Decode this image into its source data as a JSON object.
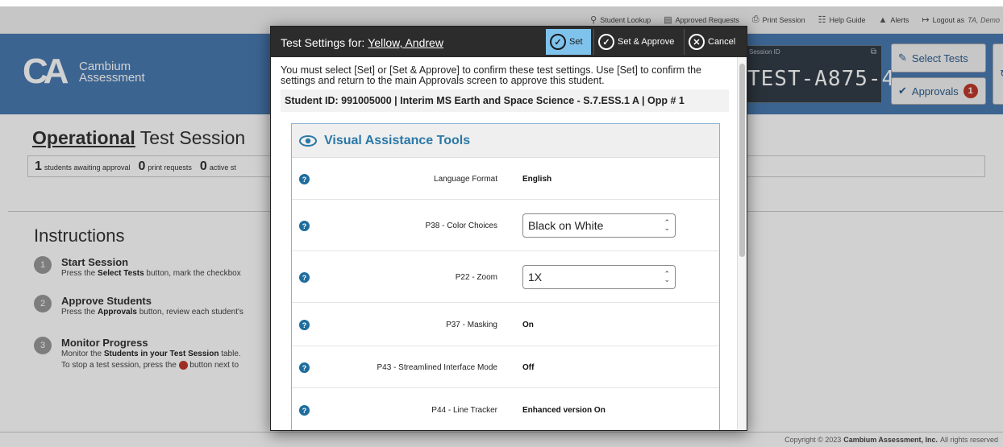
{
  "util": {
    "student_lookup": "Student Lookup",
    "approved_requests": "Approved Requests",
    "print_session": "Print Session",
    "help_guide": "Help Guide",
    "alerts": "Alerts",
    "logout_prefix": "Logout as",
    "logout_name": "TA, Demo"
  },
  "header": {
    "logo_mark": "CA",
    "logo_line1": "Cambium",
    "logo_line2": "Assessment",
    "session_label": "Session ID",
    "session_id": "TEST-A875-4",
    "select_tests": "Select Tests",
    "approvals": "Approvals",
    "approvals_count": "1"
  },
  "page": {
    "title_bold": "Operational",
    "title_rest": " Test Session",
    "stats": [
      {
        "num": "1",
        "label": "students awaiting approval"
      },
      {
        "num": "0",
        "label": "print requests"
      },
      {
        "num": "0",
        "label": "active st"
      }
    ],
    "instructions_title": "Instructions",
    "steps": [
      {
        "num": "1",
        "title": "Start Session",
        "pre": "Press the ",
        "bold": "Select Tests",
        "post": " button, mark the checkbox"
      },
      {
        "num": "2",
        "title": "Approve Students",
        "pre": "Press the ",
        "bold": "Approvals",
        "post": " button, review each student's"
      },
      {
        "num": "3",
        "title": "Monitor Progress",
        "pre": "Monitor the ",
        "bold": "Students in your Test Session",
        "post": " table.",
        "line2_pre": "To stop a test session, press the ",
        "line2_post": " button next to"
      }
    ],
    "footer_pre": "Copyright © 2023",
    "footer_bold": "Cambium Assessment, Inc.",
    "footer_post": "All rights reserved"
  },
  "modal": {
    "title_prefix": "Test Settings for:",
    "student_name": "Yellow, Andrew",
    "set_label": "Set",
    "set_approve_label": "Set & Approve",
    "cancel_label": "Cancel",
    "intro": "You must select [Set] or [Set & Approve] to confirm these test settings. Use [Set] to confirm the settings and return to the main Approvals screen to approve this student.",
    "student_line": "Student ID: 991005000 | Interim MS Earth and Space Science - S.7.ESS.1 A | Opp # 1",
    "panel_title": "Visual Assistance Tools",
    "settings": [
      {
        "label": "Language Format",
        "value": "English",
        "type": "text"
      },
      {
        "label": "P38 - Color Choices",
        "value": "Black on White",
        "type": "select"
      },
      {
        "label": "P22 - Zoom",
        "value": "1X",
        "type": "select"
      },
      {
        "label": "P37 - Masking",
        "value": "On",
        "type": "text"
      },
      {
        "label": "P43 - Streamlined Interface Mode",
        "value": "Off",
        "type": "text"
      },
      {
        "label": "P44 - Line Tracker",
        "value": "Enhanced version On",
        "type": "text"
      }
    ]
  },
  "colors": {
    "header_blue": "#4a7bb1",
    "modal_header": "#2c2c2c",
    "set_active": "#7fc3ec",
    "panel_title": "#2a78a7",
    "badge_red": "#c0392b"
  }
}
